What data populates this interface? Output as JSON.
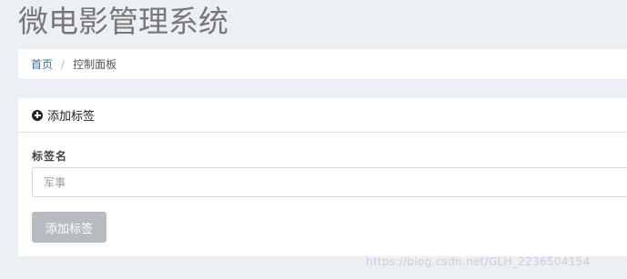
{
  "app": {
    "title": "微电影管理系统"
  },
  "breadcrumb": {
    "home": "首页",
    "separator": "/",
    "current": "控制面板"
  },
  "panel": {
    "header_icon": "plus-circle-icon",
    "header_title": "添加标签"
  },
  "form": {
    "label": "标签名",
    "input_value": "",
    "input_placeholder": "军事",
    "submit_label": "添加标签"
  },
  "watermark": "https://blog.csdn.net/GLH_2236504154",
  "colors": {
    "background": "#ecf0f5",
    "link": "#3c6f96",
    "button_disabled": "#b8bcc0"
  }
}
